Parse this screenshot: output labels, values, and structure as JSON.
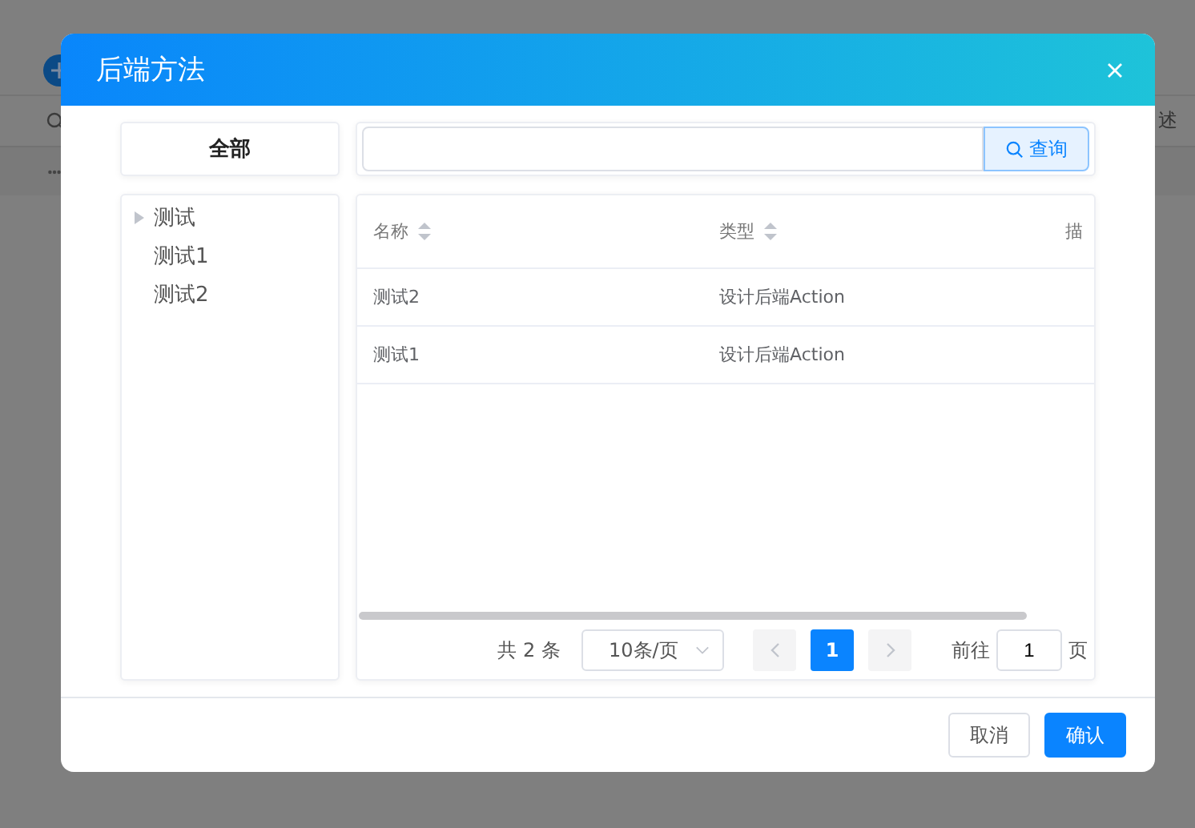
{
  "background": {
    "column_header": "述"
  },
  "dialog": {
    "title": "后端方法",
    "category_tab": "全部",
    "tree": [
      {
        "label": "测试",
        "expandable": true
      },
      {
        "label": "测试1",
        "expandable": false
      },
      {
        "label": "测试2",
        "expandable": false
      }
    ],
    "search": {
      "button": "查询"
    },
    "table": {
      "columns": [
        {
          "label": "名称",
          "sortable": true
        },
        {
          "label": "类型",
          "sortable": true
        },
        {
          "label": "描",
          "sortable": false
        }
      ],
      "rows": [
        [
          "测试2",
          "设计后端Action",
          ""
        ],
        [
          "测试1",
          "设计后端Action",
          ""
        ]
      ]
    },
    "pagination": {
      "total": "共 2 条",
      "page_size": "10条/页",
      "prev_disabled": true,
      "next_disabled": true,
      "pages": [
        {
          "label": "1",
          "selected": true
        }
      ],
      "goto_label": "前往",
      "goto_value": "1",
      "goto_suffix": "页"
    },
    "buttons": [
      {
        "label": "取消",
        "kind": "secondary"
      },
      {
        "label": "确认",
        "kind": "primary"
      }
    ]
  }
}
